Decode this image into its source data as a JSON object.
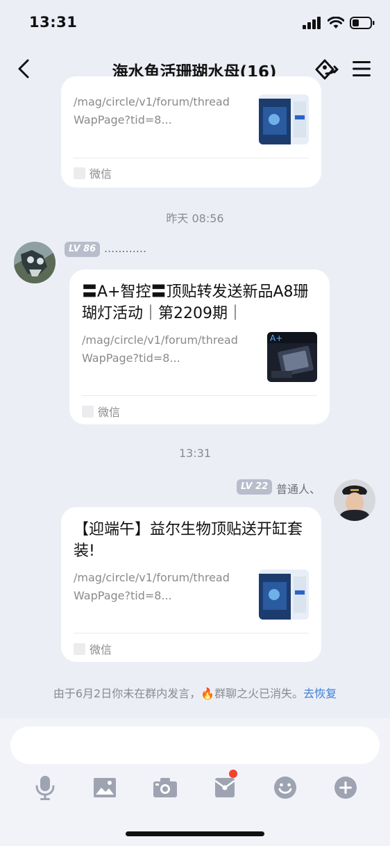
{
  "status": {
    "time": "13:31"
  },
  "header": {
    "title": "海水鱼活珊瑚水母(16)"
  },
  "messages": [
    {
      "type": "link_card",
      "url": "/mag/circle/v1/forum/threadWapPage?tid=8...",
      "source": "微信"
    },
    {
      "type": "time",
      "text": "昨天 08:56"
    },
    {
      "type": "link_card",
      "sender": {
        "level": "LV 86",
        "nickname": "............"
      },
      "title": "〓A+智控〓顶贴转发送新品A8珊 瑚灯活动｜第2209期｜",
      "url": "/mag/circle/v1/forum/threadWapPage?tid=8...",
      "source": "微信"
    },
    {
      "type": "time",
      "text": "13:31"
    },
    {
      "type": "link_card",
      "sender": {
        "level": "LV 22",
        "nickname": "普通人、"
      },
      "title": "【迎端午】益尔生物顶贴送开缸套装!",
      "url": "/mag/circle/v1/forum/threadWapPage?tid=8...",
      "source": "微信"
    }
  ],
  "notice": {
    "text": "由于6月2日你未在群内发言，",
    "fire_icon": "fire-icon",
    "text2": "群聊之火已消失。",
    "link": "去恢复"
  },
  "toolbar": {
    "icons": [
      "microphone-icon",
      "image-icon",
      "camera-icon",
      "red-packet-icon",
      "emoji-icon",
      "plus-icon"
    ]
  },
  "colors": {
    "background": "#eceef6",
    "link": "#3a7fd9",
    "badge": "#b9bccb",
    "notify_dot": "#f5412e"
  }
}
